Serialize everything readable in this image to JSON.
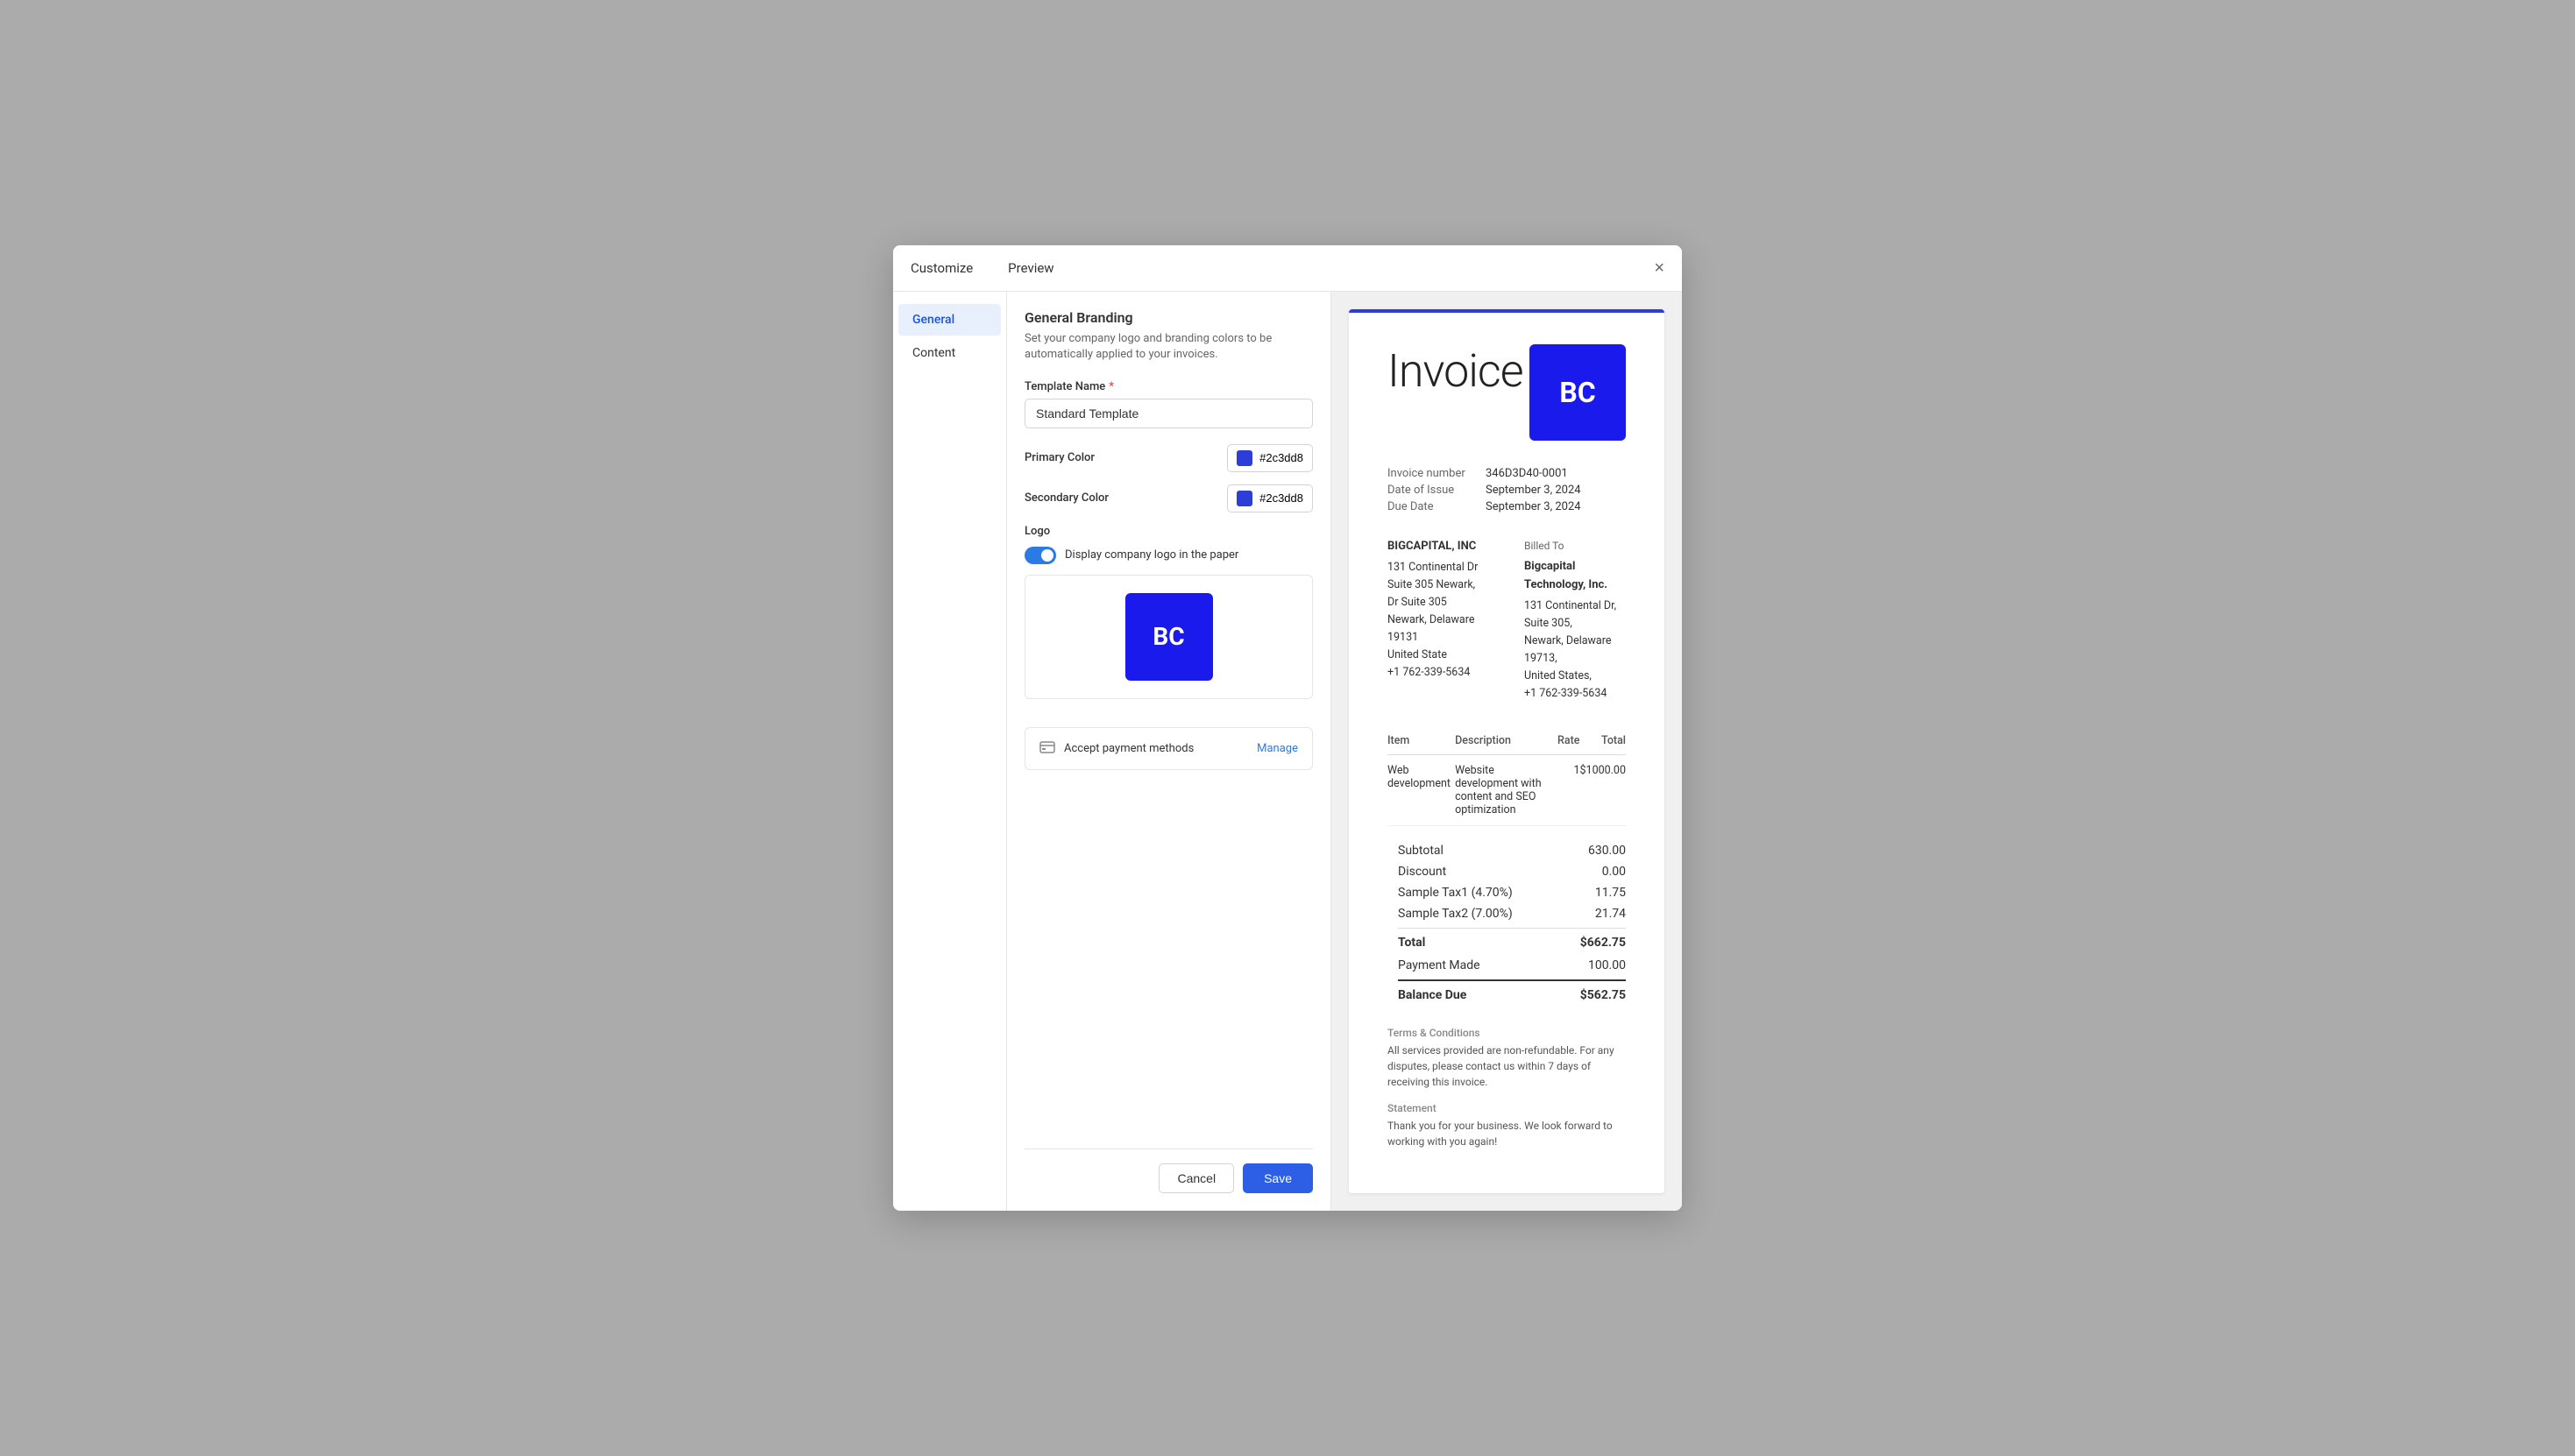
{
  "modal": {
    "customize_label": "Customize",
    "preview_label": "Preview",
    "close_label": "×"
  },
  "sidebar": {
    "items": [
      {
        "id": "general",
        "label": "General",
        "active": true
      },
      {
        "id": "content",
        "label": "Content",
        "active": false
      }
    ]
  },
  "customize": {
    "title": "General Branding",
    "description": "Set your company logo and branding colors to be automatically applied to your invoices.",
    "template_name_label": "Template Name",
    "template_name_value": "Standard Template",
    "primary_color_label": "Primary Color",
    "primary_color_value": "#2c3dd8",
    "primary_color_hex": "#2c3dd8",
    "secondary_color_label": "Secondary Color",
    "secondary_color_value": "#2c3dd8",
    "secondary_color_hex": "#2c3dd8",
    "logo_label": "Logo",
    "logo_toggle_text": "Display company logo in the paper",
    "logo_initials": "BC",
    "payment_text": "Accept payment methods",
    "manage_label": "Manage",
    "cancel_label": "Cancel",
    "save_label": "Save"
  },
  "invoice": {
    "title": "Invoice",
    "logo_initials": "BC",
    "number_label": "Invoice number",
    "number_value": "346D3D40-0001",
    "date_label": "Date of Issue",
    "date_value": "September 3, 2024",
    "due_label": "Due Date",
    "due_value": "September 3, 2024",
    "from_name": "BIGCAPITAL, INC",
    "from_address1": "131 Continental Dr Suite 305 Newark,",
    "from_address2": "Dr Suite 305",
    "from_address3": "Newark, Delaware 19131",
    "from_country": "United State",
    "from_phone": "+1 762-339-5634",
    "billed_to_header": "Billed To",
    "to_name": "Bigcapital Technology, Inc.",
    "to_address1": "131 Continental Dr,",
    "to_address2": "Suite 305,",
    "to_address3": "Newark, Delaware 19713,",
    "to_country": "United States,",
    "to_phone": "+1 762-339-5634",
    "table_headers": [
      "Item",
      "Description",
      "Rate",
      "Total"
    ],
    "table_rows": [
      {
        "item": "Web development",
        "description": "Website development with content and SEO optimization",
        "rate": "1",
        "total": "$1000.00"
      }
    ],
    "subtotal_label": "Subtotal",
    "subtotal_value": "630.00",
    "discount_label": "Discount",
    "discount_value": "0.00",
    "tax1_label": "Sample Tax1 (4.70%)",
    "tax1_value": "11.75",
    "tax2_label": "Sample Tax2 (7.00%)",
    "tax2_value": "21.74",
    "total_label": "Total",
    "total_value": "$662.75",
    "payment_label": "Payment Made",
    "payment_value": "100.00",
    "balance_label": "Balance Due",
    "balance_value": "$562.75",
    "terms_header": "Terms & Conditions",
    "terms_text": "All services provided are non-refundable. For any disputes, please contact us within 7 days of receiving this invoice.",
    "statement_header": "Statement",
    "statement_text": "Thank you for your business. We look forward to working with you again!"
  }
}
